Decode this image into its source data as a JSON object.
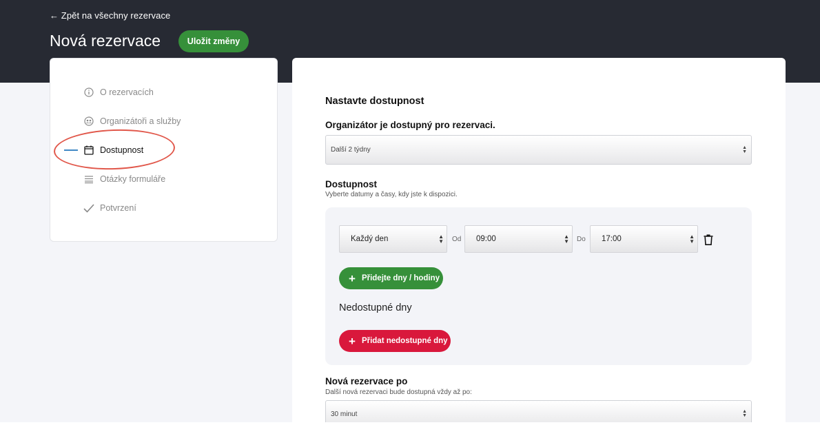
{
  "header": {
    "back_link": "← Zpět na všechny rezervace",
    "title": "Nová rezervace",
    "save_label": "Uložit změny"
  },
  "sidebar": {
    "items": [
      {
        "label": "O rezervacích",
        "icon": "info-icon"
      },
      {
        "label": "Organizátoři a služby",
        "icon": "people-icon"
      },
      {
        "label": "Dostupnost",
        "icon": "calendar-icon",
        "active": true
      },
      {
        "label": "Otázky formuláře",
        "icon": "lines-icon"
      },
      {
        "label": "Potvrzení",
        "icon": "checkmark-icon"
      }
    ]
  },
  "main": {
    "section_title": "Nastavte dostupnost",
    "organizer_label": "Organizátor je dostupný pro rezervaci.",
    "organizer_value": "Další 2 týdny",
    "availability": {
      "title": "Dostupnost",
      "hint": "Vyberte datumy a časy, kdy jste k dispozici.",
      "day_value": "Každý den",
      "from_label": "Od",
      "from_value": "09:00",
      "to_label": "Do",
      "to_value": "17:00",
      "add_label": "Přidejte dny / hodiny",
      "unavailable_title": "Nedostupné dny",
      "add_unavailable_label": "Přidat nedostupné dny"
    },
    "new_booking": {
      "title": "Nová rezervace po",
      "hint": "Další nová rezervaci bude dostupná vždy až po:",
      "value": "30 minut"
    }
  },
  "colors": {
    "header_bg": "#272a33",
    "green": "#36903a",
    "red": "#d9183c",
    "active_marker": "#3f88c5",
    "highlight": "#e1574a"
  }
}
